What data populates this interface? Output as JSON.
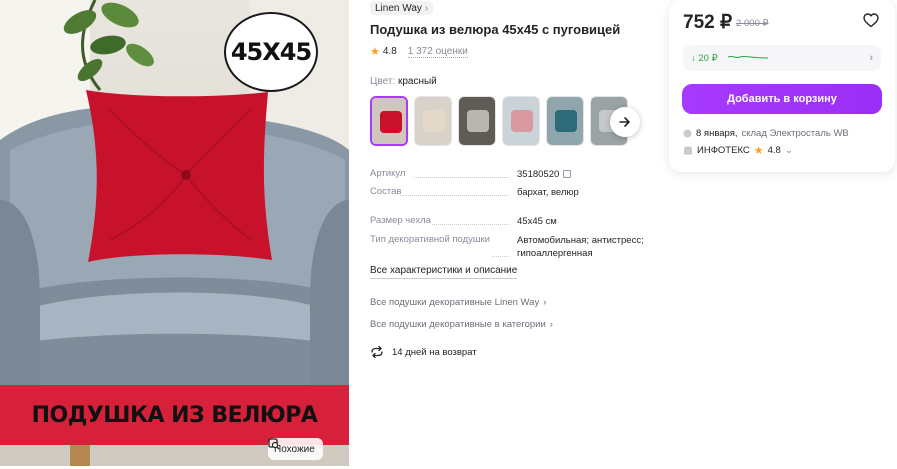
{
  "photo": {
    "badge_text": "45X45",
    "banner_text": "ПОДУШКА ИЗ ВЕЛЮРА",
    "similar_label": "Похожие"
  },
  "product": {
    "brand": "Linen Way",
    "title": "Подушка из велюра 45х45 с пуговицей",
    "rating": "4.8",
    "reviews": "1 372 оценки",
    "color_label": "Цвет:",
    "color_value": "красный",
    "thumbnails": [
      {
        "name": "red",
        "bg": "#cfc7bd",
        "pillow": "#c8122b"
      },
      {
        "name": "beige",
        "bg": "#d8d2c8",
        "pillow": "#e4d9c9"
      },
      {
        "name": "grey",
        "bg": "#5f5b55",
        "pillow": "#b9b6b0"
      },
      {
        "name": "pink",
        "bg": "#c9d3d8",
        "pillow": "#d89aa0"
      },
      {
        "name": "teal",
        "bg": "#8fa6ad",
        "pillow": "#2f6a78"
      },
      {
        "name": "lightgrey",
        "bg": "#9aa4a7",
        "pillow": "#c5c9cb"
      }
    ]
  },
  "specs": [
    {
      "key": "Артикул",
      "value": "35180520"
    },
    {
      "key": "Состав",
      "value": "бархат, велюр"
    },
    {
      "key": "Размер чехла",
      "value": "45x45 см"
    },
    {
      "key": "Тип декоративной подушки",
      "value": "Автомобильная; антистресс; гипоаллергенная"
    }
  ],
  "links": {
    "all_specs": "Все характеристики и описание",
    "brand_link": "Все подушки декоративные Linen Way",
    "category_link": "Все подушки декоративные в категории",
    "return_text": "14 дней на возврат"
  },
  "buy": {
    "price": "752 ₽",
    "old_price": "2 000 ₽",
    "installment": "↓ 20 ₽",
    "cart_button": "Добавить в корзину",
    "delivery_date": "8 января,",
    "delivery_place": "склад Электросталь WB",
    "seller": "ИНФОТЕКС",
    "seller_rating": "4.8"
  },
  "colors": {
    "accent": "#a73afd",
    "banner": "#d7203a",
    "star": "#ff9f20",
    "green": "#28a745"
  }
}
